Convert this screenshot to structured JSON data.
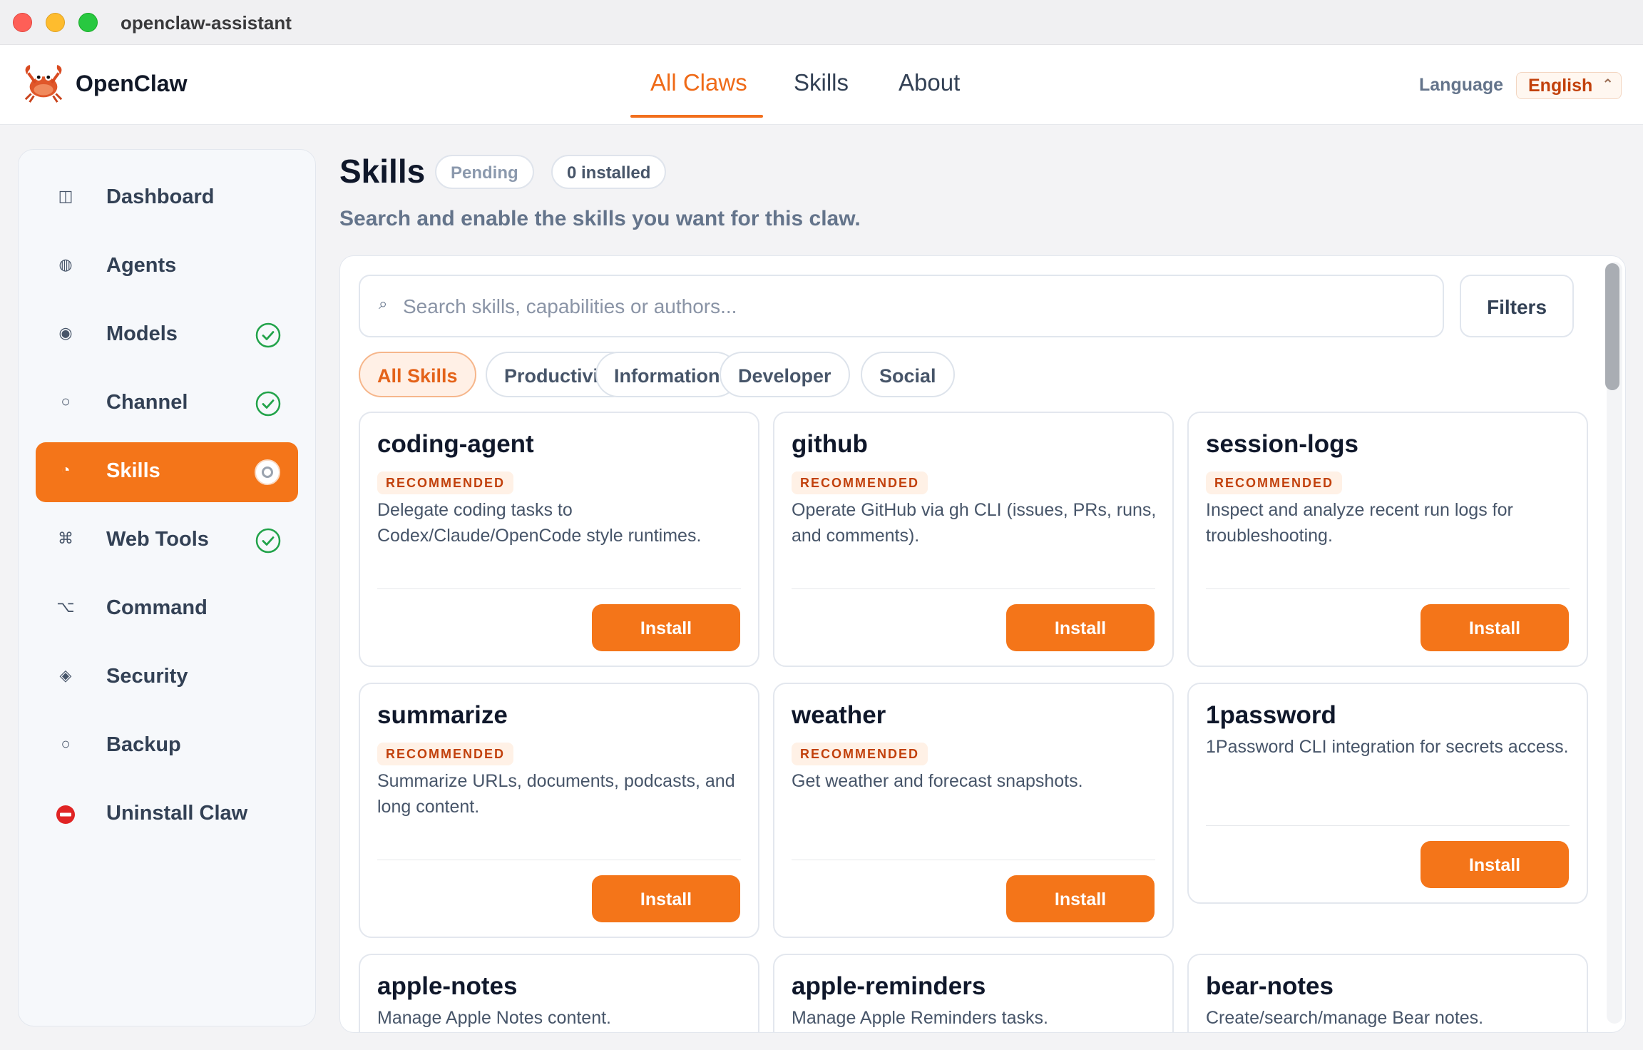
{
  "window": {
    "title": "openclaw-assistant"
  },
  "header": {
    "brand": "OpenClaw",
    "tabs": [
      {
        "label": "All Claws",
        "active": true
      },
      {
        "label": "Skills",
        "active": false
      },
      {
        "label": "About",
        "active": false
      }
    ],
    "language_label": "Language",
    "language_value": "English"
  },
  "sidebar": {
    "items": [
      {
        "label": "Dashboard",
        "icon": "dashboard-icon",
        "status": "none"
      },
      {
        "label": "Agents",
        "icon": "agents-icon",
        "status": "none"
      },
      {
        "label": "Models",
        "icon": "models-icon",
        "status": "done"
      },
      {
        "label": "Channel",
        "icon": "channel-icon",
        "status": "done"
      },
      {
        "label": "Skills",
        "icon": "skills-icon",
        "status": "current"
      },
      {
        "label": "Web Tools",
        "icon": "command-key-icon",
        "status": "done"
      },
      {
        "label": "Command",
        "icon": "option-key-icon",
        "status": "none"
      },
      {
        "label": "Security",
        "icon": "diamond-icon",
        "status": "none"
      },
      {
        "label": "Backup",
        "icon": "backup-icon",
        "status": "none"
      },
      {
        "label": "Uninstall Claw",
        "icon": "no-entry-icon",
        "status": "none"
      }
    ]
  },
  "main": {
    "title": "Skills",
    "status_pill": "Pending",
    "installed_pill": "0 installed",
    "subtitle": "Search and enable the skills you want for this claw.",
    "search_placeholder": "Search skills, capabilities or authors...",
    "search_value": "",
    "filters_label": "Filters",
    "categories": [
      "All Skills",
      "Productivity",
      "Information",
      "Developer",
      "Social"
    ],
    "active_category": "All Skills",
    "cards": [
      {
        "name": "coding-agent",
        "badge": "RECOMMENDED",
        "description": "Delegate coding tasks to Codex/Claude/OpenCode style runtimes.",
        "action": "Install"
      },
      {
        "name": "github",
        "badge": "RECOMMENDED",
        "description": "Operate GitHub via gh CLI (issues, PRs, runs, and comments).",
        "action": "Install"
      },
      {
        "name": "session-logs",
        "badge": "RECOMMENDED",
        "description": "Inspect and analyze recent run logs for troubleshooting.",
        "action": "Install"
      },
      {
        "name": "summarize",
        "badge": "RECOMMENDED",
        "description": "Summarize URLs, documents, podcasts, and long content.",
        "action": "Install"
      },
      {
        "name": "weather",
        "badge": "RECOMMENDED",
        "description": "Get weather and forecast snapshots.",
        "action": "Install"
      },
      {
        "name": "1password",
        "badge": "",
        "description": "1Password CLI integration for secrets access.",
        "action": "Install"
      },
      {
        "name": "apple-notes",
        "badge": "",
        "description": "Manage Apple Notes content.",
        "action": ""
      },
      {
        "name": "apple-reminders",
        "badge": "",
        "description": "Manage Apple Reminders tasks.",
        "action": ""
      },
      {
        "name": "bear-notes",
        "badge": "",
        "description": "Create/search/manage Bear notes.",
        "action": ""
      }
    ]
  },
  "colors": {
    "accent": "#f47519",
    "accent_text": "#ef6a17",
    "success": "#22a34a"
  }
}
